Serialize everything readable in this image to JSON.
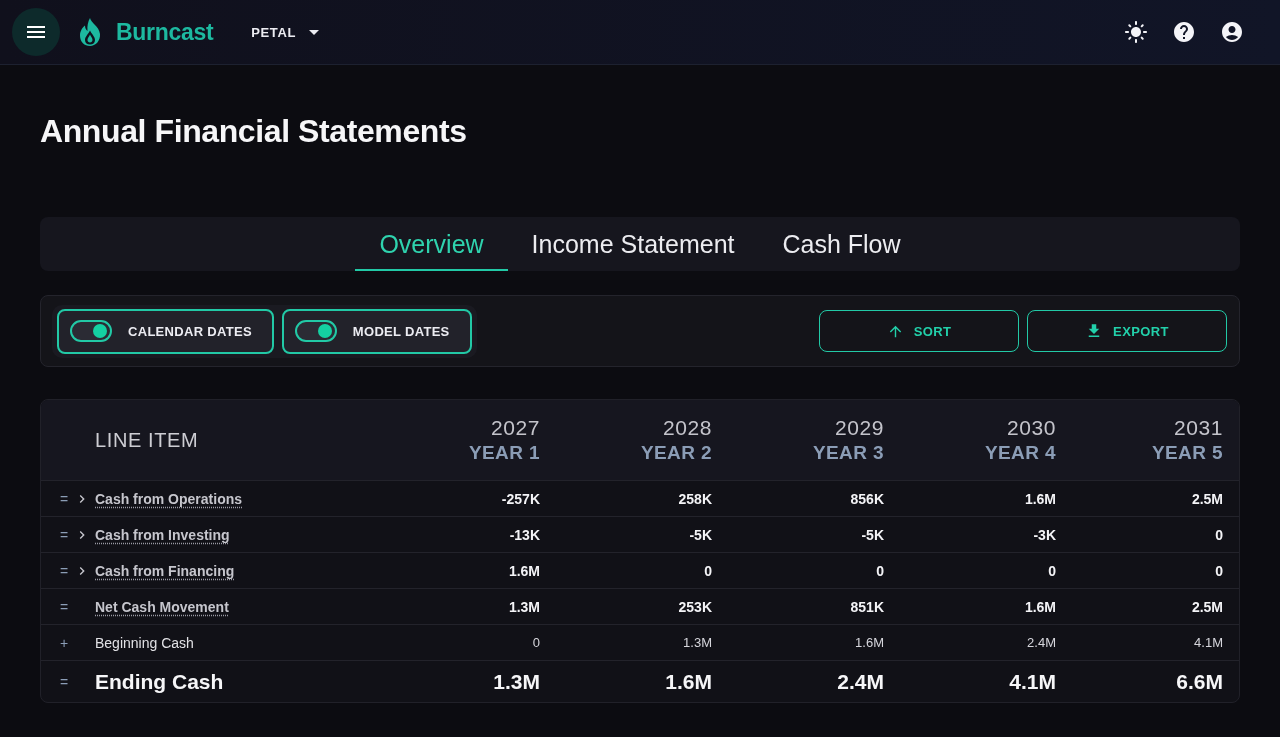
{
  "app_bar": {
    "brand": "Burncast",
    "company": "PETAL"
  },
  "page_title": "Annual Financial Statements",
  "tabs": [
    {
      "label": "Overview",
      "selected": true
    },
    {
      "label": "Income Statement",
      "selected": false
    },
    {
      "label": "Cash Flow",
      "selected": false
    }
  ],
  "toggles": [
    {
      "label": "CALENDAR DATES",
      "on": true
    },
    {
      "label": "MODEL DATES",
      "on": true
    }
  ],
  "actions": [
    {
      "label": "SORT",
      "kind": "sort"
    },
    {
      "label": "EXPORT",
      "kind": "export"
    }
  ],
  "table": {
    "columns": [
      {
        "label": "LINE ITEM"
      },
      {
        "year": "2027",
        "period": "YEAR 1"
      },
      {
        "year": "2028",
        "period": "YEAR 2"
      },
      {
        "year": "2029",
        "period": "YEAR 3"
      },
      {
        "year": "2030",
        "period": "YEAR 4"
      },
      {
        "year": "2031",
        "period": "YEAR 5"
      }
    ],
    "rows": [
      {
        "operator": "=",
        "label": "Cash from Operations",
        "kind": "group",
        "values": [
          "-257K",
          "258K",
          "856K",
          "1.6M",
          "2.5M"
        ]
      },
      {
        "operator": "=",
        "label": "Cash from Investing",
        "kind": "group",
        "values": [
          "-13K",
          "-5K",
          "-5K",
          "-3K",
          "0"
        ]
      },
      {
        "operator": "=",
        "label": "Cash from Financing",
        "kind": "group",
        "values": [
          "1.6M",
          "0",
          "0",
          "0",
          "0"
        ]
      },
      {
        "operator": "=",
        "label": "Net Cash Movement",
        "kind": "subtotal",
        "values": [
          "1.3M",
          "253K",
          "851K",
          "1.6M",
          "2.5M"
        ]
      },
      {
        "operator": "+",
        "label": "Beginning Cash",
        "kind": "item",
        "values": [
          "0",
          "1.3M",
          "1.6M",
          "2.4M",
          "4.1M"
        ]
      },
      {
        "operator": "=",
        "label": "Ending Cash",
        "kind": "total",
        "values": [
          "1.3M",
          "1.6M",
          "2.4M",
          "4.1M",
          "6.6M"
        ]
      }
    ]
  }
}
